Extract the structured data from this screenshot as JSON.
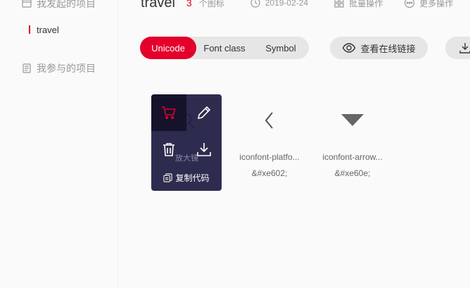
{
  "sidebar": {
    "created_label": "我发起的项目",
    "active_item": "travel",
    "joined_label": "我参与的项目"
  },
  "header": {
    "title": "travel",
    "icon_count": "3",
    "icon_count_label": "个图标",
    "date": "2019-02-24",
    "batch_label": "批量操作",
    "more_label": "更多操作"
  },
  "toolbar": {
    "tabs": [
      "Unicode",
      "Font class",
      "Symbol"
    ],
    "active_tab": "Unicode",
    "view_link_label": "查看在线链接"
  },
  "icons": [
    {
      "name": "",
      "code": "",
      "partial_name": "放大镜",
      "glyph": "magnifier-icon"
    },
    {
      "name": "iconfont-platfo...",
      "code": "&#xe602;",
      "glyph": "chevron-left-icon"
    },
    {
      "name": "iconfont-arrow...",
      "code": "&#xe60e;",
      "glyph": "caret-down-icon"
    }
  ],
  "overlay": {
    "copy_label": "复制代码"
  },
  "colors": {
    "accent": "#e4002b",
    "overlay_bg": "#232144",
    "pill_bg": "#e6e6e6"
  }
}
